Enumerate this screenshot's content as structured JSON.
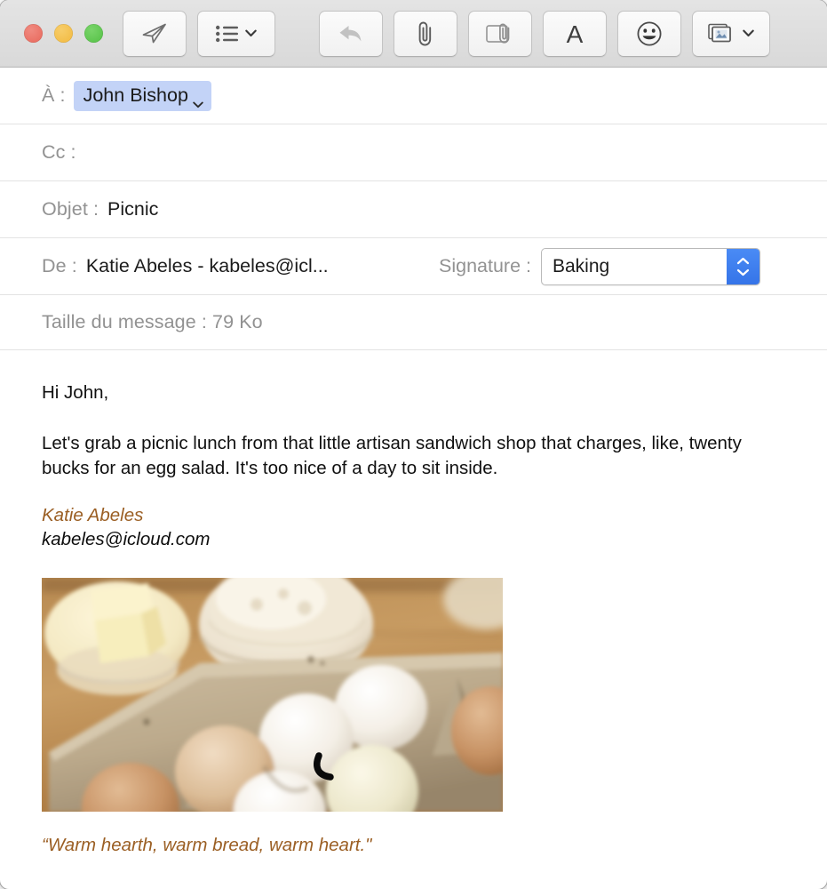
{
  "window": {
    "traffic_lights": [
      {
        "name": "close",
        "color": "#e8675a"
      },
      {
        "name": "minimize",
        "color": "#f2b93e"
      },
      {
        "name": "zoom",
        "color": "#53c044"
      }
    ]
  },
  "toolbar": {
    "buttons": [
      {
        "name": "send-button",
        "icon": "paper-plane-icon",
        "label": ""
      },
      {
        "name": "header-fields-button",
        "icon": "list-icon",
        "label": "",
        "has_chevron": true
      },
      {
        "name": "reply-button",
        "icon": "reply-arrow-icon",
        "label": "",
        "disabled": true
      },
      {
        "name": "attach-button",
        "icon": "paperclip-icon",
        "label": ""
      },
      {
        "name": "markup-button",
        "icon": "markup-attachment-icon",
        "label": ""
      },
      {
        "name": "format-button",
        "icon": "letter-a-icon",
        "label": "A"
      },
      {
        "name": "emoji-button",
        "icon": "smiley-face-icon",
        "label": ""
      },
      {
        "name": "photo-browser-button",
        "icon": "photos-icon",
        "label": "",
        "has_chevron": true
      }
    ]
  },
  "headers": {
    "to": {
      "label": "À :",
      "recipient": "John Bishop",
      "placeholder": ""
    },
    "cc": {
      "label": "Cc :",
      "value": "",
      "placeholder": ""
    },
    "subject": {
      "label": "Objet :",
      "value": "Picnic",
      "placeholder": ""
    },
    "from": {
      "label": "De :",
      "value": "Katie Abeles - kabeles@icl..."
    },
    "signature": {
      "label": "Signature :",
      "selected": "Baking"
    },
    "size": {
      "label": "Taille du message :",
      "value": "79 Ko",
      "full": "Taille du message : 79 Ko"
    }
  },
  "message": {
    "greeting": "Hi John,",
    "paragraph": "Let's grab a picnic lunch from that little artisan sandwich shop that charges, like, twenty bucks for an egg salad. It's too nice of a day to sit inside.",
    "signature_name": "Katie Abeles",
    "signature_email": "kabeles@icloud.com",
    "attachment": {
      "name": "baking-eggs-photo",
      "alt": "Eggs in a cardboard carton beside glass bowls of butter and flour on a wooden table"
    },
    "quote": "“Warm hearth, warm bread, warm heart.\""
  },
  "colors": {
    "token_bg": "#c3d3f7",
    "stepper_blue": "#3574e8",
    "signature_brown": "#9b5f24",
    "label_gray": "#929292"
  }
}
